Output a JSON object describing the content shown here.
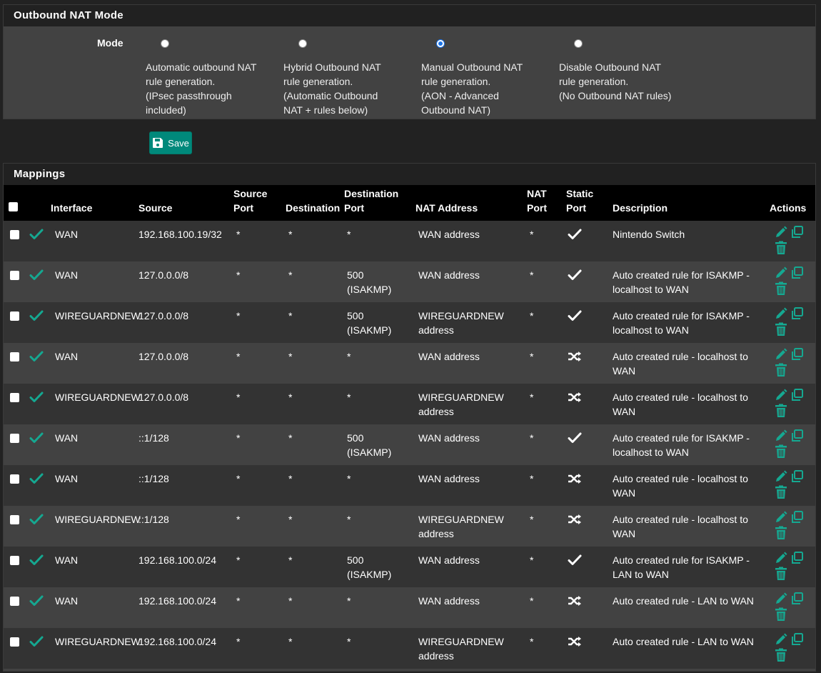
{
  "mode_panel": {
    "title": "Outbound NAT Mode",
    "label": "Mode",
    "options": [
      {
        "text": "Automatic outbound NAT rule generation. (IPsec passthrough included)",
        "lines": [
          "Automatic outbound NAT",
          "rule generation.",
          "(IPsec passthrough",
          "included)"
        ],
        "checked": false
      },
      {
        "text": "Hybrid Outbound NAT rule generation. (Automatic Outbound NAT + rules below)",
        "lines": [
          "Hybrid Outbound NAT",
          "rule generation.",
          "(Automatic Outbound",
          "NAT + rules below)"
        ],
        "checked": false
      },
      {
        "text": "Manual Outbound NAT rule generation. (AON - Advanced Outbound NAT)",
        "lines": [
          "Manual Outbound NAT",
          "rule generation.",
          "(AON - Advanced",
          "Outbound NAT)"
        ],
        "checked": true
      },
      {
        "text": "Disable Outbound NAT rule generation. (No Outbound NAT rules)",
        "lines": [
          "Disable Outbound NAT",
          "rule generation.",
          "(No Outbound NAT rules)"
        ],
        "checked": false
      }
    ]
  },
  "save_button": {
    "label": "Save",
    "icon": "save-icon"
  },
  "mappings": {
    "title": "Mappings",
    "columns": {
      "interface": "Interface",
      "source": "Source",
      "source_port": [
        "Source",
        "Port"
      ],
      "destination": "Destination",
      "destination_port": [
        "Destination",
        "Port"
      ],
      "nat_address": "NAT Address",
      "nat_port": [
        "NAT",
        "Port"
      ],
      "static_port": [
        "Static",
        "Port"
      ],
      "description": "Description",
      "actions": "Actions"
    },
    "rows": [
      {
        "interface": "WAN",
        "source": "192.168.100.19/32",
        "source_port": "*",
        "destination": "*",
        "destination_port": [
          "*"
        ],
        "nat_address": [
          "WAN address"
        ],
        "nat_port": "*",
        "static_port": "check",
        "description": [
          "Nintendo Switch"
        ]
      },
      {
        "interface": "WAN",
        "source": "127.0.0.0/8",
        "source_port": "*",
        "destination": "*",
        "destination_port": [
          "500",
          "(ISAKMP)"
        ],
        "nat_address": [
          "WAN address"
        ],
        "nat_port": "*",
        "static_port": "check",
        "description": [
          "Auto created rule for ISAKMP -",
          "localhost to WAN"
        ]
      },
      {
        "interface": "WIREGUARDNEW",
        "source": "127.0.0.0/8",
        "source_port": "*",
        "destination": "*",
        "destination_port": [
          "500",
          "(ISAKMP)"
        ],
        "nat_address": [
          "WIREGUARDNEW",
          "address"
        ],
        "nat_port": "*",
        "static_port": "check",
        "description": [
          "Auto created rule for ISAKMP -",
          "localhost to WAN"
        ]
      },
      {
        "interface": "WAN",
        "source": "127.0.0.0/8",
        "source_port": "*",
        "destination": "*",
        "destination_port": [
          "*"
        ],
        "nat_address": [
          "WAN address"
        ],
        "nat_port": "*",
        "static_port": "random",
        "description": [
          "Auto created rule - localhost to",
          "WAN"
        ]
      },
      {
        "interface": "WIREGUARDNEW",
        "source": "127.0.0.0/8",
        "source_port": "*",
        "destination": "*",
        "destination_port": [
          "*"
        ],
        "nat_address": [
          "WIREGUARDNEW",
          "address"
        ],
        "nat_port": "*",
        "static_port": "random",
        "description": [
          "Auto created rule - localhost to",
          "WAN"
        ]
      },
      {
        "interface": "WAN",
        "source": "::1/128",
        "source_port": "*",
        "destination": "*",
        "destination_port": [
          "500",
          "(ISAKMP)"
        ],
        "nat_address": [
          "WAN address"
        ],
        "nat_port": "*",
        "static_port": "check",
        "description": [
          "Auto created rule for ISAKMP -",
          "localhost to WAN"
        ]
      },
      {
        "interface": "WAN",
        "source": "::1/128",
        "source_port": "*",
        "destination": "*",
        "destination_port": [
          "*"
        ],
        "nat_address": [
          "WAN address"
        ],
        "nat_port": "*",
        "static_port": "random",
        "description": [
          "Auto created rule - localhost to",
          "WAN"
        ]
      },
      {
        "interface": "WIREGUARDNEW",
        "source": "::1/128",
        "source_port": "*",
        "destination": "*",
        "destination_port": [
          "*"
        ],
        "nat_address": [
          "WIREGUARDNEW",
          "address"
        ],
        "nat_port": "*",
        "static_port": "random",
        "description": [
          "Auto created rule - localhost to",
          "WAN"
        ]
      },
      {
        "interface": "WAN",
        "source": "192.168.100.0/24",
        "source_port": "*",
        "destination": "*",
        "destination_port": [
          "500",
          "(ISAKMP)"
        ],
        "nat_address": [
          "WAN address"
        ],
        "nat_port": "*",
        "static_port": "check",
        "description": [
          "Auto created rule for ISAKMP -",
          "LAN to WAN"
        ]
      },
      {
        "interface": "WAN",
        "source": "192.168.100.0/24",
        "source_port": "*",
        "destination": "*",
        "destination_port": [
          "*"
        ],
        "nat_address": [
          "WAN address"
        ],
        "nat_port": "*",
        "static_port": "random",
        "description": [
          "Auto created rule - LAN to WAN"
        ]
      },
      {
        "interface": "WIREGUARDNEW",
        "source": "192.168.100.0/24",
        "source_port": "*",
        "destination": "*",
        "destination_port": [
          "*"
        ],
        "nat_address": [
          "WIREGUARDNEW",
          "address"
        ],
        "nat_port": "*",
        "static_port": "random",
        "description": [
          "Auto created rule - LAN to WAN"
        ]
      }
    ]
  },
  "colors": {
    "accent": "#00897b",
    "enabled_check": "#15a891",
    "bg": "#222222",
    "panel": "#424242",
    "header": "#000000"
  }
}
